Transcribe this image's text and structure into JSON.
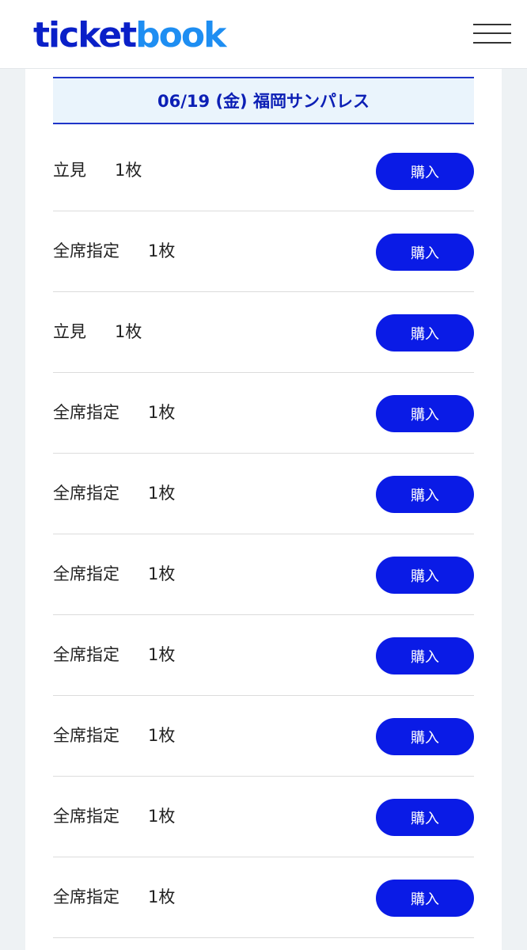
{
  "header": {
    "logo_part1": "ticket",
    "logo_part2": "book",
    "menu_icon": "hamburger-menu-icon"
  },
  "event": {
    "date_venue": "06/19 (金) 福岡サンパレス"
  },
  "tickets": [
    {
      "type": "立見",
      "quantity": "1枚",
      "button": "購入"
    },
    {
      "type": "全席指定",
      "quantity": "1枚",
      "button": "購入"
    },
    {
      "type": "立見",
      "quantity": "1枚",
      "button": "購入"
    },
    {
      "type": "全席指定",
      "quantity": "1枚",
      "button": "購入"
    },
    {
      "type": "全席指定",
      "quantity": "1枚",
      "button": "購入"
    },
    {
      "type": "全席指定",
      "quantity": "1枚",
      "button": "購入"
    },
    {
      "type": "全席指定",
      "quantity": "1枚",
      "button": "購入"
    },
    {
      "type": "全席指定",
      "quantity": "1枚",
      "button": "購入"
    },
    {
      "type": "全席指定",
      "quantity": "1枚",
      "button": "購入"
    },
    {
      "type": "全席指定",
      "quantity": "1枚",
      "button": "購入"
    }
  ],
  "colors": {
    "brand_dark": "#0a20c8",
    "brand_light": "#1e8ef2",
    "button": "#0a1be6",
    "date_bar_bg": "#eaf4fc"
  }
}
